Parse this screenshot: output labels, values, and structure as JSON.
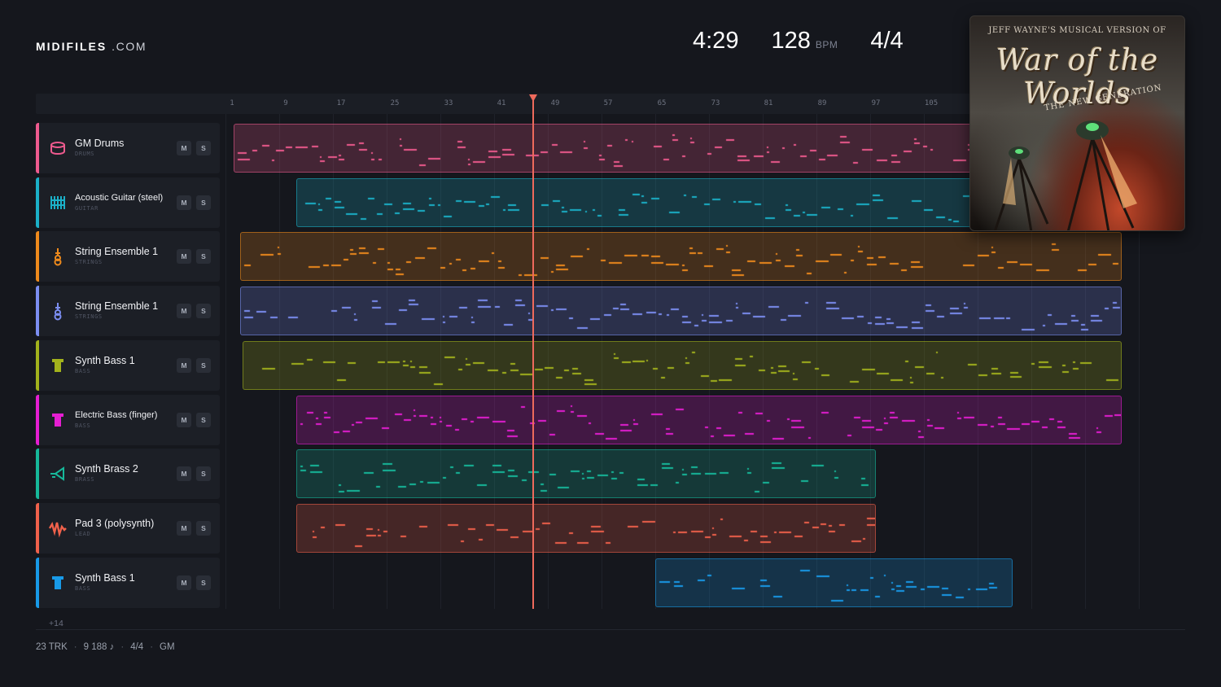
{
  "brand": {
    "name": "MIDIFILES",
    "suffix": ".COM"
  },
  "stats": {
    "duration": "4:29",
    "tempo": "128",
    "tempo_unit": "BPM",
    "time_signature": "4/4"
  },
  "ruler": {
    "bars": [
      "1",
      "9",
      "17",
      "25",
      "33",
      "41",
      "49",
      "57",
      "65",
      "73",
      "81",
      "89",
      "97",
      "105"
    ]
  },
  "colors": {
    "drums": "#ee5a8e",
    "guitar": "#1bb0c8",
    "strings1": "#ee8a1c",
    "strings2": "#7c8ef2",
    "synthbass1": "#a2b21c",
    "elecbass": "#e51ed2",
    "brass": "#16b89a",
    "pad": "#f0614b",
    "synthbass2": "#189ae8",
    "playhead": "#ee6a5c"
  },
  "tracks": [
    {
      "name": "GM Drums",
      "category": "DRUMS",
      "icon": "drum-icon",
      "color": "#ee5a8e",
      "mute": "M",
      "solo": "S"
    },
    {
      "name": "Acoustic Guitar (steel)",
      "category": "GUITAR",
      "icon": "guitar-icon",
      "color": "#1bb0c8",
      "mute": "M",
      "solo": "S"
    },
    {
      "name": "String Ensemble 1",
      "category": "STRINGS",
      "icon": "violin-icon",
      "color": "#ee8a1c",
      "mute": "M",
      "solo": "S"
    },
    {
      "name": "String Ensemble 1",
      "category": "STRINGS",
      "icon": "violin-icon",
      "color": "#7c8ef2",
      "mute": "M",
      "solo": "S"
    },
    {
      "name": "Synth Bass 1",
      "category": "BASS",
      "icon": "bass-icon",
      "color": "#a2b21c",
      "mute": "M",
      "solo": "S"
    },
    {
      "name": "Electric Bass (finger)",
      "category": "BASS",
      "icon": "bass-icon",
      "color": "#e51ed2",
      "mute": "M",
      "solo": "S"
    },
    {
      "name": "Synth Brass 2",
      "category": "BRASS",
      "icon": "horn-icon",
      "color": "#16b89a",
      "mute": "M",
      "solo": "S"
    },
    {
      "name": "Pad 3 (polysynth)",
      "category": "LEAD",
      "icon": "wave-icon",
      "color": "#f0614b",
      "mute": "M",
      "solo": "S"
    },
    {
      "name": "Synth Bass 1",
      "category": "BASS",
      "icon": "bass-icon",
      "color": "#189ae8",
      "mute": "M",
      "solo": "S"
    }
  ],
  "more_tracks": "+14",
  "footer": {
    "tracks": "23 TRK",
    "notes": "9 188 ♪",
    "time_signature": "4/4",
    "standard": "GM"
  },
  "album": {
    "top_text": "JEFF WAYNE'S MUSICAL VERSION OF",
    "title": "War of the Worlds",
    "subtitle": "THE NEW GENERATION"
  }
}
